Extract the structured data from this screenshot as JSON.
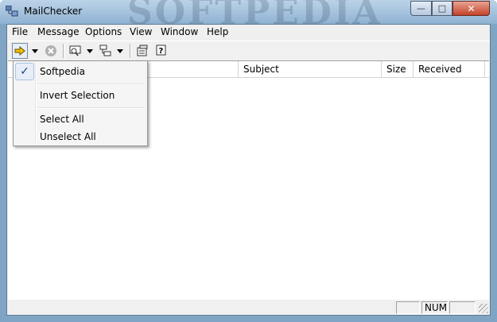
{
  "window": {
    "title": "MailChecker",
    "watermark": "SOFTPEDIA",
    "minimize_glyph": "—",
    "maximize_glyph": "□",
    "close_glyph": "✕"
  },
  "menu": {
    "items": [
      "File",
      "Message",
      "Options",
      "View",
      "Window",
      "Help"
    ]
  },
  "toolbar": {
    "icons": [
      "check-mail-icon",
      "dropdown-arrow-icon",
      "stop-icon",
      "preview-icon",
      "dropdown-arrow-icon",
      "move-icon",
      "dropdown-arrow-icon",
      "properties-icon",
      "help-icon"
    ]
  },
  "list": {
    "columns": [
      "",
      "Subject",
      "Size",
      "Received"
    ]
  },
  "dropdown_menu": {
    "checked_glyph": "✓",
    "items": [
      "Softpedia",
      "Invert Selection",
      "Select All",
      "Unselect All"
    ]
  },
  "status": {
    "num": "NUM"
  },
  "colors": {
    "titlebar": "#8fb2d2",
    "close_button": "#c4422b",
    "check_mail_arrow": "#f2c200"
  }
}
